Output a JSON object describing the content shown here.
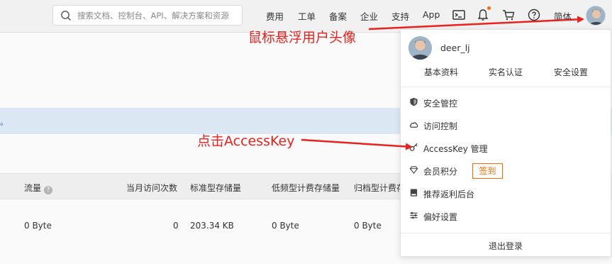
{
  "search": {
    "placeholder": "搜索文档、控制台、API、解决方案和资源"
  },
  "nav": {
    "items": [
      "费用",
      "工单",
      "备案",
      "企业",
      "支持",
      "App"
    ],
    "partial_item": "简体"
  },
  "content": {
    "info_text": "。",
    "table": {
      "headers": [
        "流量",
        "当月访问次数",
        "标准型存储量",
        "低频型计费存储量",
        "归档型计费存"
      ],
      "row": [
        "0 Byte",
        "0",
        "203.34 KB",
        "0 Byte",
        "0 Byte"
      ]
    }
  },
  "dropdown": {
    "username": "deer_lj",
    "top_links": [
      "基本资料",
      "实名认证",
      "安全设置"
    ],
    "menu": [
      {
        "label": "安全管控",
        "icon": "shield-icon"
      },
      {
        "label": "访问控制",
        "icon": "cloud-icon"
      },
      {
        "label": "AccessKey 管理",
        "icon": "key-icon"
      },
      {
        "label": "会员积分",
        "icon": "diamond-icon"
      },
      {
        "label": "推荐返利后台",
        "icon": "gift-icon"
      },
      {
        "label": "偏好设置",
        "icon": "sliders-icon"
      }
    ],
    "signin_label": "签到",
    "logout_label": "退出登录"
  },
  "annotations": {
    "avatar_note": "鼠标悬浮用户头像",
    "accesskey_note": "点击AccessKey"
  },
  "colors": {
    "accent": "#ff6a00",
    "annotation": "#e8221f",
    "info_bg": "#dbe8f4"
  }
}
